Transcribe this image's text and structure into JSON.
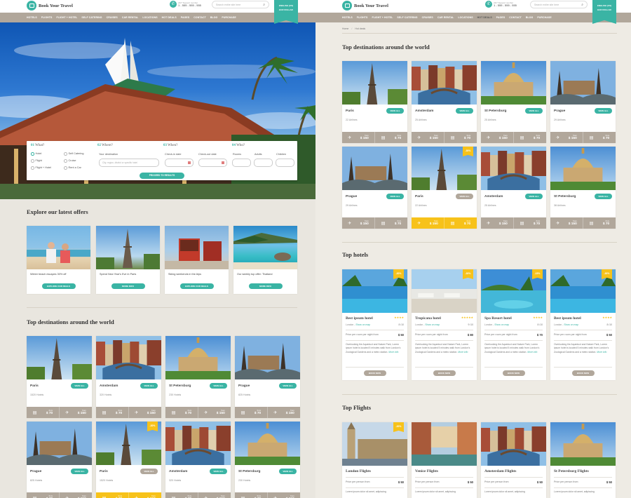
{
  "brand": {
    "name": "Book Your Travel"
  },
  "header": {
    "phone_label": "24/7 Support number",
    "phone": "1 - 555 - 555 - 555",
    "search_placeholder": "Search entire site here",
    "ribbon_lang": "ENGLISH (US)",
    "ribbon_cur": "EUR DOLLAR"
  },
  "nav": [
    "HOTELS",
    "FLIGHTS",
    "FLIGHT + HOTEL",
    "SELF CATERING",
    "CRUISES",
    "CAR RENTAL",
    "LOCATIONS",
    "HOT DEALS",
    "PAGES",
    "CONTACT",
    "BLOG",
    "PURCHASE"
  ],
  "breadcrumb": {
    "home": "Home",
    "sep": "/",
    "current": "Hot deals"
  },
  "search": {
    "step1": {
      "num": "01",
      "title": "What?"
    },
    "step2": {
      "num": "02",
      "title": "Where?"
    },
    "step3": {
      "num": "03",
      "title": "When?"
    },
    "step4": {
      "num": "04",
      "title": "Who?"
    },
    "what_options": [
      "Hotel",
      "Self Catering",
      "Flight",
      "Cruise",
      "Flight + Hotel",
      "Rent a Car"
    ],
    "dest_label": "Your destination",
    "dest_placeholder": "City, region, district or specific hotel",
    "checkin_label": "Check-in date",
    "checkout_label": "Check-out date",
    "rooms_label": "Rooms",
    "adults_label": "Adults",
    "children_label": "Children",
    "button": "PROCEED TO RESULTS"
  },
  "offers": {
    "title": "Explore our latest offers",
    "items": [
      {
        "text": "Winter beach escapes 30% off",
        "button": "EXPLORE OUR DEALS"
      },
      {
        "text": "Spend New Year's Eve in Paris",
        "button": "MORE INFO"
      },
      {
        "text": "Skiing weekends in the Alps",
        "button": "EXPLORE OUR DEALS"
      },
      {
        "text": "Our weekly top offer: Thailand",
        "button": "MORE INFO"
      }
    ]
  },
  "left_destinations": {
    "title": "Top destinations around the world",
    "items": [
      {
        "name": "Paris",
        "count": "1520 Hotels",
        "button": "VIEW ALL",
        "from": "from",
        "price1": "$ 70",
        "price2": "$ 150"
      },
      {
        "name": "Amsterdam",
        "count": "320 Hotels",
        "button": "VIEW ALL",
        "from": "from",
        "price1": "$ 70",
        "price2": "$ 150"
      },
      {
        "name": "St Petersburg",
        "count": "230 Hotels",
        "button": "VIEW ALL",
        "from": "from",
        "price1": "$ 70",
        "price2": "$ 150"
      },
      {
        "name": "Prague",
        "count": "825 Hotels",
        "button": "VIEW ALL",
        "from": "from",
        "price1": "$ 70",
        "price2": "$ 150"
      },
      {
        "name": "Prague",
        "count": "825 Hotels",
        "button": "VIEW ALL",
        "from": "from",
        "price1": "$ 70",
        "price2": "$ 150"
      },
      {
        "name": "Paris",
        "count": "1520 Hotels",
        "button": "VIEW ALL",
        "from": "from",
        "price1": "$ 70",
        "price2": "$ 150",
        "badge": "-30%"
      },
      {
        "name": "Amsterdam",
        "count": "320 Hotels",
        "button": "VIEW ALL",
        "from": "from",
        "price1": "$ 70",
        "price2": "$ 150"
      },
      {
        "name": "St Petersburg",
        "count": "230 Hotels",
        "button": "VIEW ALL",
        "from": "from",
        "price1": "$ 70",
        "price2": "$ 150"
      }
    ]
  },
  "right_destinations": {
    "title": "Top destinations around the world",
    "items": [
      {
        "name": "Paris",
        "count": "22 Airlines",
        "button": "VIEW ALL",
        "from": "from",
        "price1": "$ 150",
        "price2": "$ 70"
      },
      {
        "name": "Amsterdam",
        "count": "25 Airlines",
        "button": "VIEW ALL",
        "from": "from",
        "price1": "$ 150",
        "price2": "$ 70"
      },
      {
        "name": "St Petersburg",
        "count": "25 Airlines",
        "button": "VIEW ALL",
        "from": "from",
        "price1": "$ 150",
        "price2": "$ 70"
      },
      {
        "name": "Prague",
        "count": "29 Airlines",
        "button": "VIEW ALL",
        "from": "from",
        "price1": "$ 150",
        "price2": "$ 70"
      },
      {
        "name": "Prague",
        "count": "29 Airlines",
        "button": "VIEW ALL",
        "from": "from",
        "price1": "$ 150",
        "price2": "$ 70"
      },
      {
        "name": "Paris",
        "count": "22 Airlines",
        "button": "VIEW ALL",
        "from": "from",
        "price1": "$ 150",
        "price2": "$ 70",
        "badge": "-30%"
      },
      {
        "name": "Amsterdam",
        "count": "25 Airlines",
        "button": "VIEW ALL",
        "from": "from",
        "price1": "$ 150",
        "price2": "$ 70"
      },
      {
        "name": "St Petersburg",
        "count": "38 Airlines",
        "button": "VIEW ALL",
        "from": "from",
        "price1": "$ 150",
        "price2": "$ 70"
      }
    ]
  },
  "hotels": {
    "title": "Top hotels",
    "items": [
      {
        "name": "Best ipsum hotel",
        "stars": "★★★★",
        "loc": "London",
        "showmap": "Show on map",
        "rating": "8 /10",
        "price_label": "Price per room per night from",
        "price": "$ 50",
        "desc": "Overlooking the Aqueduct and Nature Park, Lorem ipsum hotel is located 5 minutes walk from London's Zoological Gardens and a metro station.",
        "more": "More info",
        "button": "BOOK NOW",
        "badge": "-30%"
      },
      {
        "name": "Tropicana hotel",
        "stars": "★★★★★",
        "loc": "London",
        "showmap": "Show on map",
        "rating": "9 /10",
        "price_label": "Price per room per night from",
        "price": "$ 80",
        "desc": "Overlooking the Aqueduct and Nature Park, Lorem ipsum hotel is located 5 minutes walk from London's Zoological Gardens and a metro station.",
        "more": "More info",
        "button": "BOOK NOW",
        "badge": "-30%"
      },
      {
        "name": "Spa Resort hotel",
        "stars": "★★★★",
        "loc": "London",
        "showmap": "Show on map",
        "rating": "8 /10",
        "price_label": "Price per room per night from",
        "price": "$ 70",
        "desc": "Overlooking the Aqueduct and Nature Park, Lorem ipsum hotel is located 5 minutes walk from London's Zoological Gardens and a metro station.",
        "more": "More info",
        "button": "BOOK NOW",
        "badge": "-15%"
      },
      {
        "name": "Best ipsum hotel",
        "stars": "★★★★",
        "loc": "London",
        "showmap": "Show on map",
        "rating": "8 /10",
        "price_label": "Price per room per night from",
        "price": "$ 50",
        "desc": "Overlooking the Aqueduct and Nature Park, Lorem ipsum hotel is located 5 minutes walk from London's Zoological Gardens and a metro station.",
        "more": "More info",
        "button": "BOOK NOW",
        "badge": "-30%"
      }
    ]
  },
  "flights": {
    "title": "Top Flights",
    "items": [
      {
        "name": "London Flights",
        "price_label": "Price per person from",
        "price": "$ 50",
        "desc": "Lorem ipsum dolor sit amet, adipiscing",
        "badge": "-30%"
      },
      {
        "name": "Venice Flights",
        "price_label": "Price per person from",
        "price": "$ 50",
        "desc": "Lorem ipsum dolor sit amet, adipiscing"
      },
      {
        "name": "Amsterdam Flights",
        "price_label": "Price per person from",
        "price": "$ 50",
        "desc": "Lorem ipsum dolor sit amet, adipiscing"
      },
      {
        "name": "St Petersburg Flights",
        "price_label": "Price per person from",
        "price": "$ 50",
        "desc": "Lorem ipsum dolor sit amet, adipiscing"
      }
    ]
  },
  "colors": {
    "accent": "#3ab4a4",
    "taupe": "#b1a79b",
    "highlight": "#f7c21a"
  },
  "icons": [
    "suitcase-icon",
    "phone-icon",
    "search-icon",
    "plane-icon",
    "hotel-icon",
    "calendar-icon",
    "map-pin-icon"
  ]
}
